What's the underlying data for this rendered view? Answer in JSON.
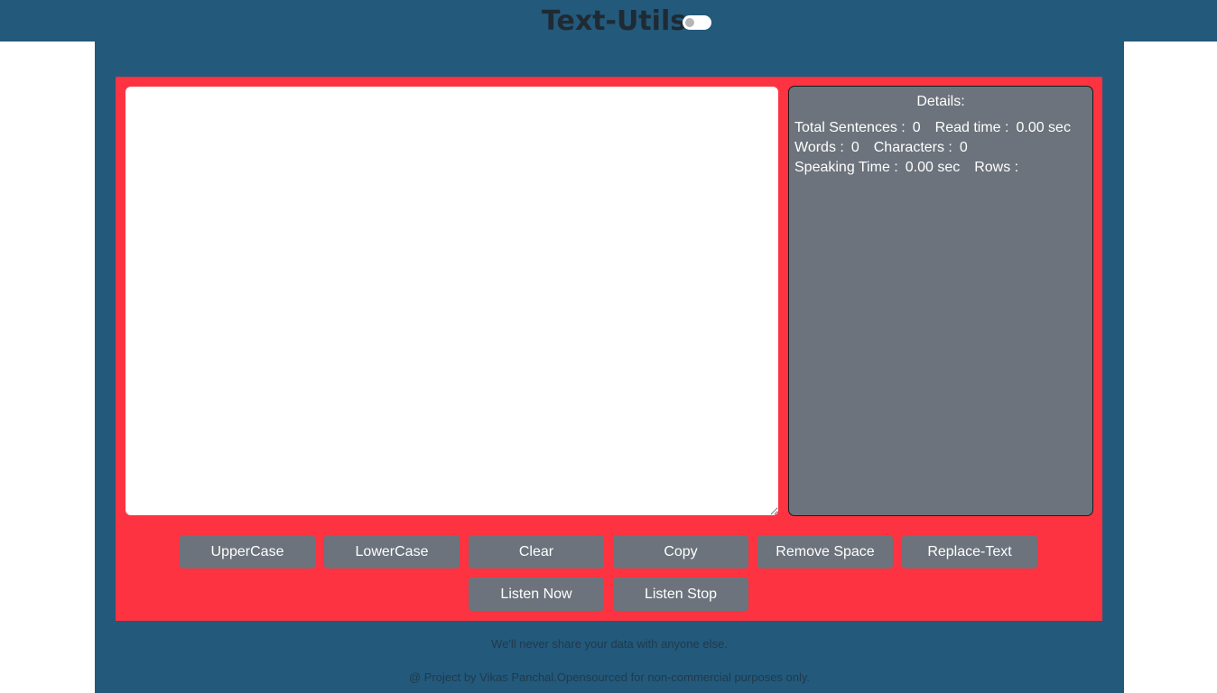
{
  "header": {
    "title": "Text-Utils",
    "dark_mode_toggle": "toggle-switch"
  },
  "editor": {
    "value": "",
    "placeholder": ""
  },
  "details": {
    "title": "Details:",
    "total_sentences_label": "Total Sentences :",
    "total_sentences_value": "0",
    "read_time_label": "Read time :",
    "read_time_value": "0.00 sec",
    "words_label": "Words :",
    "words_value": "0",
    "characters_label": "Characters :",
    "characters_value": "0",
    "speaking_time_label": "Speaking Time :",
    "speaking_time_value": "0.00 sec",
    "rows_label": "Rows :",
    "rows_value": ""
  },
  "buttons": {
    "uppercase": "UpperCase",
    "lowercase": "LowerCase",
    "clear": "Clear",
    "copy": "Copy",
    "remove_space": "Remove Space",
    "replace_text": "Replace-Text",
    "listen_now": "Listen Now",
    "listen_stop": "Listen Stop"
  },
  "footer": {
    "note": "We'll never share your data with anyone else.",
    "credit": "@ Project by Vikas Panchal.Opensourced for non-commercial purposes only."
  },
  "colors": {
    "header_bg": "#23597b",
    "card_bg": "#fe3341",
    "button_bg": "#6c737c",
    "details_bg": "#6c737c"
  }
}
